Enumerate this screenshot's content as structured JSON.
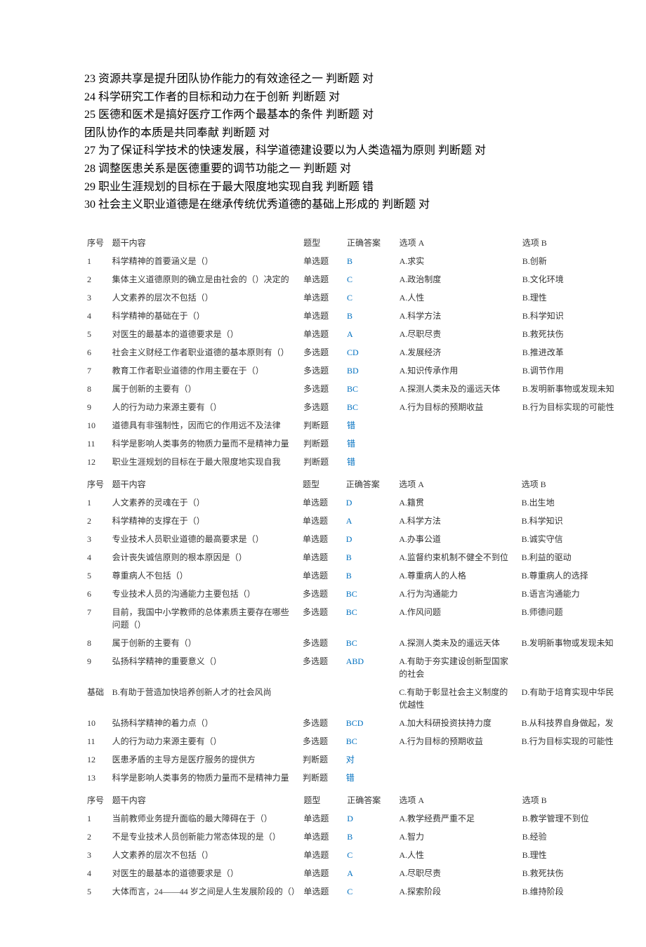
{
  "intro": [
    "23 资源共享是提升团队协作能力的有效途径之一  判断题    对",
    "24 科学研究工作者的目标和动力在于创新  判断题    对",
    "25 医德和医术是搞好医疗工作两个最基本的条件  判断题    对",
    "团队协作的本质是共同奉献  判断题    对",
    "27 为了保证科学技术的快速发展，科学道德建设要以为人类造福为原则  判断题    对",
    "28 调整医患关系是医德重要的调节功能之一  判断题    对",
    "29 职业生涯规划的目标在于最大限度地实现自我  判断题    错",
    "30 社会主义职业道德是在继承传统优秀道德的基础上形成的  判断题    对"
  ],
  "headers": {
    "seq": "序号",
    "content": "题干内容",
    "type": "题型",
    "ans": "正确答案",
    "optA": "选项 A",
    "optB": "选项 B"
  },
  "table1": [
    {
      "seq": "1",
      "content": "科学精神的首要涵义是（）",
      "type": "单选题",
      "ans": "B",
      "optA": "A.求实",
      "optB": "B.创新"
    },
    {
      "seq": "2",
      "content": "集体主义道德原则的确立是由社会的（）决定的",
      "type": "单选题",
      "ans": "C",
      "optA": "A.政治制度",
      "optB": "B.文化环境"
    },
    {
      "seq": "3",
      "content": "人文素养的层次不包括（）",
      "type": "单选题",
      "ans": "C",
      "optA": "A.人性",
      "optB": "B.理性"
    },
    {
      "seq": "4",
      "content": "科学精神的基础在于（）",
      "type": "单选题",
      "ans": "B",
      "optA": "A.科学方法",
      "optB": "B.科学知识"
    },
    {
      "seq": "5",
      "content": "对医生的最基本的道德要求是（）",
      "type": "单选题",
      "ans": "A",
      "optA": "A.尽职尽责",
      "optB": "B.救死扶伤"
    },
    {
      "seq": "6",
      "content": "社会主义财经工作者职业道德的基本原则有（）",
      "type": "多选题",
      "ans": "CD",
      "optA": "A.发展经济",
      "optB": "B.推进改革"
    },
    {
      "seq": "7",
      "content": "教育工作者职业道德的作用主要在于（）",
      "type": "多选题",
      "ans": "BD",
      "optA": "A.知识传承作用",
      "optB": "B.调节作用"
    },
    {
      "seq": "8",
      "content": "属于创新的主要有（）",
      "type": "多选题",
      "ans": "BC",
      "optA": "A.探测人类未及的遥远天体",
      "optB": "B.发明新事物或发现未知"
    },
    {
      "seq": "9",
      "content": "人的行为动力来源主要有（）",
      "type": "多选题",
      "ans": "BC",
      "optA": "A.行为目标的预期收益",
      "optB": "B.行为目标实现的可能性"
    },
    {
      "seq": "10",
      "content": "道德具有非强制性，因而它的作用远不及法律",
      "type": "判断题",
      "ans": "错",
      "optA": "",
      "optB": ""
    },
    {
      "seq": "11",
      "content": "科学是影响人类事务的物质力量而不是精神力量",
      "type": "判断题",
      "ans": "错",
      "optA": "",
      "optB": ""
    },
    {
      "seq": "12",
      "content": "职业生涯规划的目标在于最大限度地实现自我",
      "type": "判断题",
      "ans": "错",
      "optA": "",
      "optB": ""
    }
  ],
  "table2": [
    {
      "seq": "1",
      "content": "人文素养的灵魂在于（）",
      "type": "单选题",
      "ans": "D",
      "optA": "A.籍贯",
      "optB": "B.出生地"
    },
    {
      "seq": "2",
      "content": "科学精神的支撑在于（）",
      "type": "单选题",
      "ans": "A",
      "optA": "A.科学方法",
      "optB": "B.科学知识"
    },
    {
      "seq": "3",
      "content": "专业技术人员职业道德的最高要求是（）",
      "type": "单选题",
      "ans": "D",
      "optA": "A.办事公道",
      "optB": "B.诚实守信"
    },
    {
      "seq": "4",
      "content": "会计丧失诚信原则的根本原因是（）",
      "type": "单选题",
      "ans": "B",
      "optA": "A.监督约束机制不健全不到位",
      "optB": "B.利益的驱动"
    },
    {
      "seq": "5",
      "content": "尊重病人不包括（）",
      "type": "单选题",
      "ans": "B",
      "optA": "A.尊重病人的人格",
      "optB": "B.尊重病人的选择"
    },
    {
      "seq": "6",
      "content": "专业技术人员的沟通能力主要包括（）",
      "type": "多选题",
      "ans": "BC",
      "optA": "A.行为沟通能力",
      "optB": "B.语言沟通能力"
    },
    {
      "seq": "7",
      "content": "目前，我国中小学教师的总体素质主要存在哪些问题（）",
      "type": "多选题",
      "ans": "BC",
      "optA": "A.作风问题",
      "optB": "B.师德问题"
    },
    {
      "seq": "8",
      "content": "属于创新的主要有（）",
      "type": "多选题",
      "ans": "BC",
      "optA": "A.探测人类未及的遥远天体",
      "optB": "B.发明新事物或发现未知"
    }
  ],
  "row9": {
    "line1": {
      "seq": "9",
      "content": "弘扬科学精神的重要意义（）",
      "type": "多选题",
      "ans": "ABD",
      "optA": "A.有助于夯实建设创新型国家的社会",
      "optB": ""
    },
    "line2": {
      "seq": "基础",
      "content": "B.有助于营造加快培养创新人才的社会风尚",
      "type": "",
      "ans": "",
      "optA": "C.有助于彰显社会主义制度的优越性",
      "optB": "D.有助于培育实现中华民"
    }
  },
  "table2b": [
    {
      "seq": "10",
      "content": "弘扬科学精神的着力点（）",
      "type": "多选题",
      "ans": "BCD",
      "optA": "A.加大科研投资扶持力度",
      "optB": "B.从科技界自身做起，发"
    },
    {
      "seq": "11",
      "content": "人的行为动力来源主要有（）",
      "type": "多选题",
      "ans": "BC",
      "optA": "A.行为目标的预期收益",
      "optB": "B.行为目标实现的可能性"
    },
    {
      "seq": "12",
      "content": "医患矛盾的主导方是医疗服务的提供方",
      "type": "判断题",
      "ans": "对",
      "optA": "",
      "optB": ""
    },
    {
      "seq": "13",
      "content": "科学是影响人类事务的物质力量而不是精神力量",
      "type": "判断题",
      "ans": "错",
      "optA": "",
      "optB": ""
    }
  ],
  "table3": [
    {
      "seq": "1",
      "content": "当前教师业务提升面临的最大障碍在于（）",
      "type": "单选题",
      "ans": "D",
      "optA": "A.教学经费严重不足",
      "optB": "B.教学管理不到位"
    },
    {
      "seq": "2",
      "content": "不是专业技术人员创新能力常态体现的是（）",
      "type": "单选题",
      "ans": "B",
      "optA": "A.智力",
      "optB": "B.经验"
    },
    {
      "seq": "3",
      "content": "人文素养的层次不包括（）",
      "type": "单选题",
      "ans": "C",
      "optA": "A.人性",
      "optB": "B.理性"
    },
    {
      "seq": "4",
      "content": "对医生的最基本的道德要求是（）",
      "type": "单选题",
      "ans": "A",
      "optA": "A.尽职尽责",
      "optB": "B.救死扶伤"
    },
    {
      "seq": "5",
      "content": "大体而言，24——44 岁之间是人生发展阶段的（）",
      "type": "单选题",
      "ans": "C",
      "optA": "A.探索阶段",
      "optB": "B.维持阶段"
    }
  ]
}
